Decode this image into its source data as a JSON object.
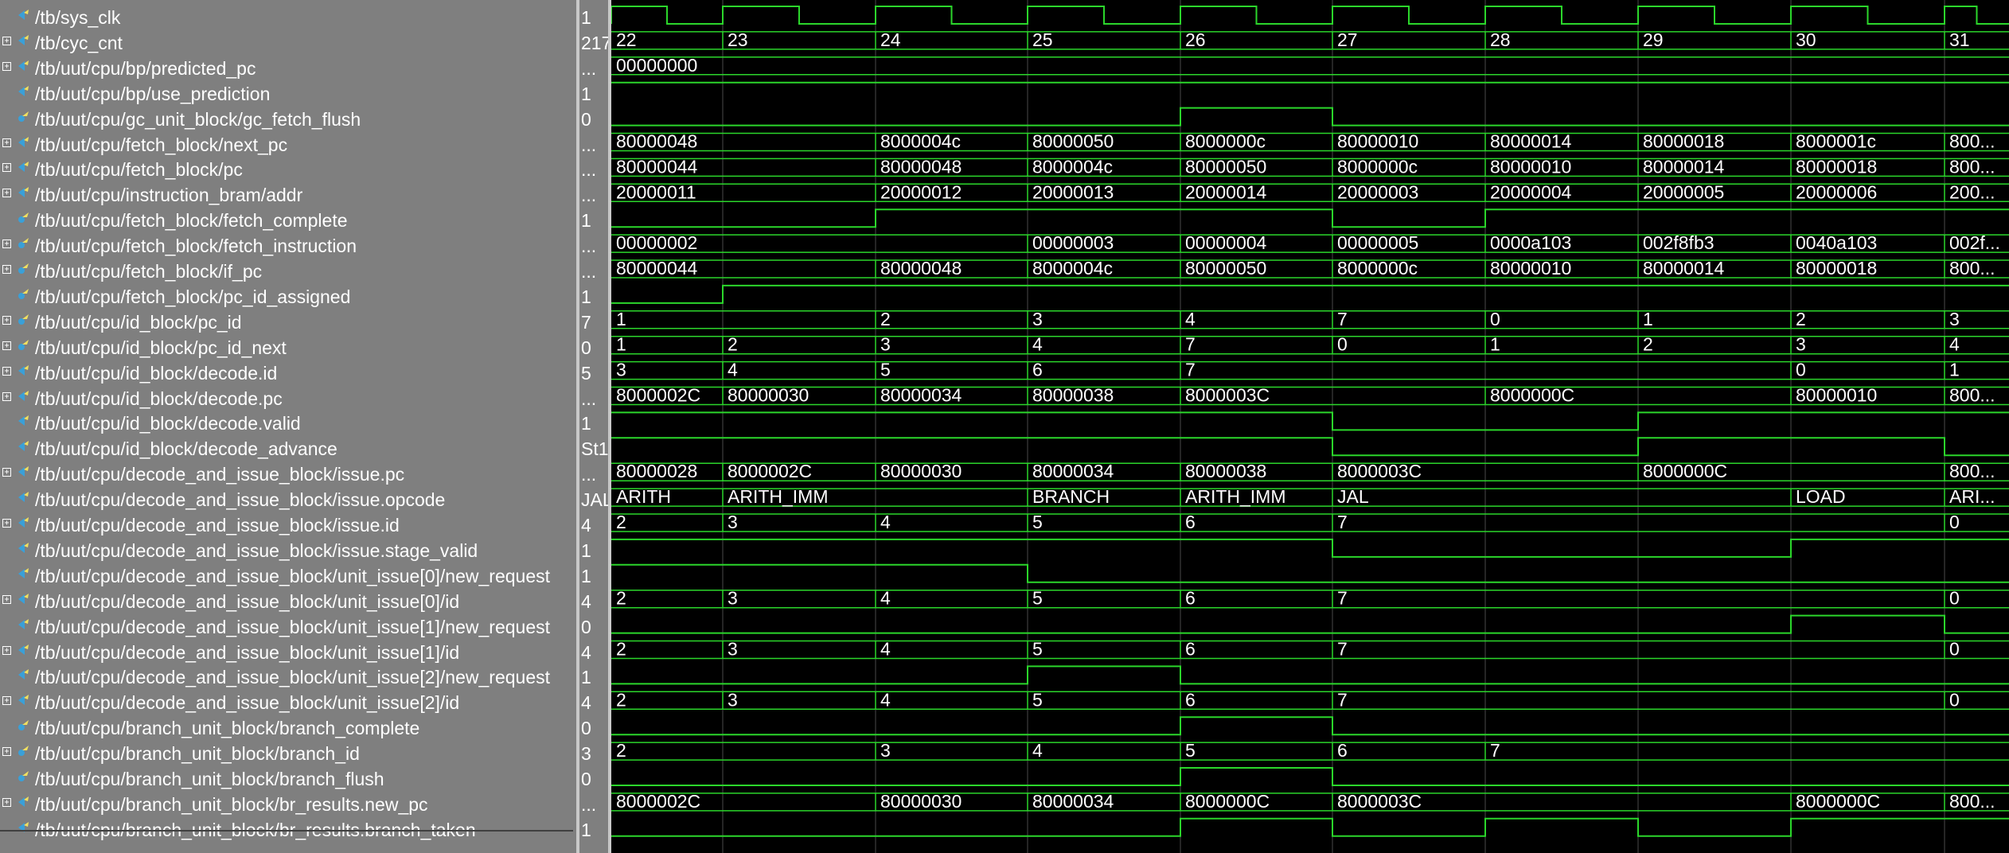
{
  "colors": {
    "wave": "#2bd62b",
    "text": "#ffffff",
    "grid": "#3a3a3a"
  },
  "cursor_cycles": [
    "22",
    "23",
    "24",
    "25",
    "26",
    "27",
    "28",
    "29",
    "30",
    "31"
  ],
  "signals": [
    {
      "name": "/tb/sys_clk",
      "value": "1",
      "icon": "input-icon",
      "expandable": false,
      "kind": "clock"
    },
    {
      "name": "/tb/cyc_cnt",
      "value": "217",
      "icon": "input-icon",
      "expandable": true,
      "kind": "bus",
      "segs": [
        [
          "22",
          0
        ],
        [
          "23",
          1
        ],
        [
          "24",
          2
        ],
        [
          "25",
          3
        ],
        [
          "26",
          4
        ],
        [
          "27",
          5
        ],
        [
          "28",
          6
        ],
        [
          "29",
          7
        ],
        [
          "30",
          8
        ],
        [
          "31",
          9
        ]
      ]
    },
    {
      "name": "/tb/uut/cpu/bp/predicted_pc",
      "value": "...",
      "icon": "input-icon",
      "expandable": true,
      "kind": "bus",
      "segs": [
        [
          "00000000",
          0
        ]
      ]
    },
    {
      "name": "/tb/uut/cpu/bp/use_prediction",
      "value": "1",
      "icon": "input-icon",
      "expandable": false,
      "kind": "bit",
      "bits": [
        [
          0,
          1
        ]
      ]
    },
    {
      "name": "/tb/uut/cpu/gc_unit_block/gc_fetch_flush",
      "value": "0",
      "icon": "internal-icon",
      "expandable": false,
      "kind": "bit",
      "bits": [
        [
          0,
          0
        ],
        [
          4,
          1
        ],
        [
          5,
          0
        ]
      ]
    },
    {
      "name": "/tb/uut/cpu/fetch_block/next_pc",
      "value": "...",
      "icon": "input-icon",
      "expandable": true,
      "kind": "bus",
      "segs": [
        [
          "80000048",
          0
        ],
        [
          "8000004c",
          2
        ],
        [
          "80000050",
          3
        ],
        [
          "8000000c",
          4
        ],
        [
          "80000010",
          5
        ],
        [
          "80000014",
          6
        ],
        [
          "80000018",
          7
        ],
        [
          "8000001c",
          8
        ],
        [
          "800...",
          9
        ]
      ]
    },
    {
      "name": "/tb/uut/cpu/fetch_block/pc",
      "value": "...",
      "icon": "input-icon",
      "expandable": true,
      "kind": "bus",
      "segs": [
        [
          "80000044",
          0
        ],
        [
          "80000048",
          2
        ],
        [
          "8000004c",
          3
        ],
        [
          "80000050",
          4
        ],
        [
          "8000000c",
          5
        ],
        [
          "80000010",
          6
        ],
        [
          "80000014",
          7
        ],
        [
          "80000018",
          8
        ],
        [
          "800...",
          9
        ]
      ]
    },
    {
      "name": "/tb/uut/cpu/instruction_bram/addr",
      "value": "...",
      "icon": "input-icon",
      "expandable": true,
      "kind": "bus",
      "segs": [
        [
          "20000011",
          0
        ],
        [
          "20000012",
          2
        ],
        [
          "20000013",
          3
        ],
        [
          "20000014",
          4
        ],
        [
          "20000003",
          5
        ],
        [
          "20000004",
          6
        ],
        [
          "20000005",
          7
        ],
        [
          "20000006",
          8
        ],
        [
          "200...",
          9
        ]
      ]
    },
    {
      "name": "/tb/uut/cpu/fetch_block/fetch_complete",
      "value": "1",
      "icon": "internal-icon",
      "expandable": false,
      "kind": "bit",
      "bits": [
        [
          0,
          0
        ],
        [
          2,
          1
        ],
        [
          5,
          0
        ],
        [
          6,
          1
        ]
      ]
    },
    {
      "name": "/tb/uut/cpu/fetch_block/fetch_instruction",
      "value": "...",
      "icon": "internal-icon",
      "expandable": true,
      "kind": "bus",
      "segs": [
        [
          "00000002",
          0
        ],
        [
          "00000003",
          3
        ],
        [
          "00000004",
          4
        ],
        [
          "00000005",
          5
        ],
        [
          "0000a103",
          6
        ],
        [
          "002f8fb3",
          7
        ],
        [
          "0040a103",
          8
        ],
        [
          "002f...",
          9
        ]
      ]
    },
    {
      "name": "/tb/uut/cpu/fetch_block/if_pc",
      "value": "...",
      "icon": "internal-icon",
      "expandable": true,
      "kind": "bus",
      "segs": [
        [
          "80000044",
          0
        ],
        [
          "80000048",
          2
        ],
        [
          "8000004c",
          3
        ],
        [
          "80000050",
          4
        ],
        [
          "8000000c",
          5
        ],
        [
          "80000010",
          6
        ],
        [
          "80000014",
          7
        ],
        [
          "80000018",
          8
        ],
        [
          "800...",
          9
        ]
      ]
    },
    {
      "name": "/tb/uut/cpu/fetch_block/pc_id_assigned",
      "value": "1",
      "icon": "internal-icon",
      "expandable": false,
      "kind": "bit",
      "bits": [
        [
          0,
          0
        ],
        [
          1,
          1
        ]
      ]
    },
    {
      "name": "/tb/uut/cpu/id_block/pc_id",
      "value": "7",
      "icon": "internal-icon",
      "expandable": true,
      "kind": "bus",
      "segs": [
        [
          "1",
          0
        ],
        [
          "2",
          2
        ],
        [
          "3",
          3
        ],
        [
          "4",
          4
        ],
        [
          "7",
          5
        ],
        [
          "0",
          6
        ],
        [
          "1",
          7
        ],
        [
          "2",
          8
        ],
        [
          "3",
          9
        ]
      ]
    },
    {
      "name": "/tb/uut/cpu/id_block/pc_id_next",
      "value": "0",
      "icon": "internal-icon",
      "expandable": true,
      "kind": "bus",
      "segs": [
        [
          "1",
          0
        ],
        [
          "2",
          1
        ],
        [
          "3",
          2
        ],
        [
          "4",
          3
        ],
        [
          "7",
          4
        ],
        [
          "0",
          5
        ],
        [
          "1",
          6
        ],
        [
          "2",
          7
        ],
        [
          "3",
          8
        ],
        [
          "4",
          9
        ]
      ]
    },
    {
      "name": "/tb/uut/cpu/id_block/decode.id",
      "value": "5",
      "icon": "input-icon",
      "expandable": true,
      "kind": "bus",
      "segs": [
        [
          "3",
          0
        ],
        [
          "4",
          1
        ],
        [
          "5",
          2
        ],
        [
          "6",
          3
        ],
        [
          "7",
          4
        ],
        [
          "0",
          8
        ],
        [
          "1",
          9
        ]
      ]
    },
    {
      "name": "/tb/uut/cpu/id_block/decode.pc",
      "value": "...",
      "icon": "input-icon",
      "expandable": true,
      "kind": "bus",
      "segs": [
        [
          "8000002C",
          0
        ],
        [
          "80000030",
          1
        ],
        [
          "80000034",
          2
        ],
        [
          "80000038",
          3
        ],
        [
          "8000003C",
          4
        ],
        [
          "8000000C",
          6
        ],
        [
          "80000010",
          8
        ],
        [
          "800...",
          9
        ]
      ]
    },
    {
      "name": "/tb/uut/cpu/id_block/decode.valid",
      "value": "1",
      "icon": "input-icon",
      "expandable": false,
      "kind": "bit",
      "bits": [
        [
          0,
          1
        ],
        [
          5,
          0
        ],
        [
          7,
          1
        ]
      ]
    },
    {
      "name": "/tb/uut/cpu/id_block/decode_advance",
      "value": "St1",
      "icon": "input-icon",
      "expandable": false,
      "kind": "bit",
      "bits": [
        [
          0,
          1
        ],
        [
          5,
          0
        ],
        [
          7,
          1
        ],
        [
          9,
          0
        ]
      ]
    },
    {
      "name": "/tb/uut/cpu/decode_and_issue_block/issue.pc",
      "value": "...",
      "icon": "input-icon",
      "expandable": true,
      "kind": "bus",
      "segs": [
        [
          "80000028",
          0
        ],
        [
          "8000002C",
          1
        ],
        [
          "80000030",
          2
        ],
        [
          "80000034",
          3
        ],
        [
          "80000038",
          4
        ],
        [
          "8000003C",
          5
        ],
        [
          "8000000C",
          7
        ],
        [
          "800...",
          9
        ]
      ]
    },
    {
      "name": "/tb/uut/cpu/decode_and_issue_block/issue.opcode",
      "value": "JAL",
      "icon": "input-icon",
      "expandable": false,
      "kind": "bus",
      "segs": [
        [
          "ARITH",
          0
        ],
        [
          "ARITH_IMM",
          1
        ],
        [
          "BRANCH",
          3
        ],
        [
          "ARITH_IMM",
          4
        ],
        [
          "JAL",
          5
        ],
        [
          "LOAD",
          8
        ],
        [
          "ARI...",
          9
        ]
      ]
    },
    {
      "name": "/tb/uut/cpu/decode_and_issue_block/issue.id",
      "value": "4",
      "icon": "input-icon",
      "expandable": true,
      "kind": "bus",
      "segs": [
        [
          "2",
          0
        ],
        [
          "3",
          1
        ],
        [
          "4",
          2
        ],
        [
          "5",
          3
        ],
        [
          "6",
          4
        ],
        [
          "7",
          5
        ],
        [
          "0",
          9
        ]
      ]
    },
    {
      "name": "/tb/uut/cpu/decode_and_issue_block/issue.stage_valid",
      "value": "1",
      "icon": "input-icon",
      "expandable": false,
      "kind": "bit",
      "bits": [
        [
          0,
          1
        ],
        [
          5,
          0
        ],
        [
          8,
          1
        ]
      ]
    },
    {
      "name": "/tb/uut/cpu/decode_and_issue_block/unit_issue[0]/new_request",
      "value": "1",
      "icon": "input-icon",
      "expandable": false,
      "kind": "bit",
      "bits": [
        [
          0,
          1
        ],
        [
          3,
          0
        ]
      ]
    },
    {
      "name": "/tb/uut/cpu/decode_and_issue_block/unit_issue[0]/id",
      "value": "4",
      "icon": "input-icon",
      "expandable": true,
      "kind": "bus",
      "segs": [
        [
          "2",
          0
        ],
        [
          "3",
          1
        ],
        [
          "4",
          2
        ],
        [
          "5",
          3
        ],
        [
          "6",
          4
        ],
        [
          "7",
          5
        ],
        [
          "0",
          9
        ]
      ]
    },
    {
      "name": "/tb/uut/cpu/decode_and_issue_block/unit_issue[1]/new_request",
      "value": "0",
      "icon": "input-icon",
      "expandable": false,
      "kind": "bit",
      "bits": [
        [
          0,
          0
        ],
        [
          8,
          1
        ],
        [
          9,
          0
        ]
      ]
    },
    {
      "name": "/tb/uut/cpu/decode_and_issue_block/unit_issue[1]/id",
      "value": "4",
      "icon": "input-icon",
      "expandable": true,
      "kind": "bus",
      "segs": [
        [
          "2",
          0
        ],
        [
          "3",
          1
        ],
        [
          "4",
          2
        ],
        [
          "5",
          3
        ],
        [
          "6",
          4
        ],
        [
          "7",
          5
        ],
        [
          "0",
          9
        ]
      ]
    },
    {
      "name": "/tb/uut/cpu/decode_and_issue_block/unit_issue[2]/new_request",
      "value": "1",
      "icon": "input-icon",
      "expandable": false,
      "kind": "bit",
      "bits": [
        [
          0,
          0
        ],
        [
          3,
          1
        ],
        [
          4,
          0
        ]
      ]
    },
    {
      "name": "/tb/uut/cpu/decode_and_issue_block/unit_issue[2]/id",
      "value": "4",
      "icon": "input-icon",
      "expandable": true,
      "kind": "bus",
      "segs": [
        [
          "2",
          0
        ],
        [
          "3",
          1
        ],
        [
          "4",
          2
        ],
        [
          "5",
          3
        ],
        [
          "6",
          4
        ],
        [
          "7",
          5
        ],
        [
          "0",
          9
        ]
      ]
    },
    {
      "name": "/tb/uut/cpu/branch_unit_block/branch_complete",
      "value": "0",
      "icon": "internal-icon",
      "expandable": false,
      "kind": "bit",
      "bits": [
        [
          0,
          0
        ],
        [
          4,
          1
        ],
        [
          5,
          0
        ]
      ]
    },
    {
      "name": "/tb/uut/cpu/branch_unit_block/branch_id",
      "value": "3",
      "icon": "internal-icon",
      "expandable": true,
      "kind": "bus",
      "segs": [
        [
          "2",
          0
        ],
        [
          "3",
          2
        ],
        [
          "4",
          3
        ],
        [
          "5",
          4
        ],
        [
          "6",
          5
        ],
        [
          "7",
          6
        ]
      ]
    },
    {
      "name": "/tb/uut/cpu/branch_unit_block/branch_flush",
      "value": "0",
      "icon": "internal-icon",
      "expandable": false,
      "kind": "bit",
      "bits": [
        [
          0,
          0
        ],
        [
          4,
          1
        ],
        [
          5,
          0
        ]
      ]
    },
    {
      "name": "/tb/uut/cpu/branch_unit_block/br_results.new_pc",
      "value": "...",
      "icon": "input-icon",
      "expandable": true,
      "kind": "bus",
      "segs": [
        [
          "8000002C",
          0
        ],
        [
          "80000030",
          2
        ],
        [
          "80000034",
          3
        ],
        [
          "8000000C",
          4
        ],
        [
          "8000003C",
          5
        ],
        [
          "8000000C",
          8
        ],
        [
          "800...",
          9
        ]
      ]
    },
    {
      "name": "/tb/uut/cpu/branch_unit_block/br_results.branch_taken",
      "value": "1",
      "icon": "input-icon",
      "expandable": false,
      "kind": "bit",
      "bits": [
        [
          0,
          0
        ],
        [
          4,
          1
        ],
        [
          5,
          0
        ],
        [
          6,
          1
        ],
        [
          7,
          0
        ],
        [
          8,
          1
        ]
      ]
    }
  ]
}
